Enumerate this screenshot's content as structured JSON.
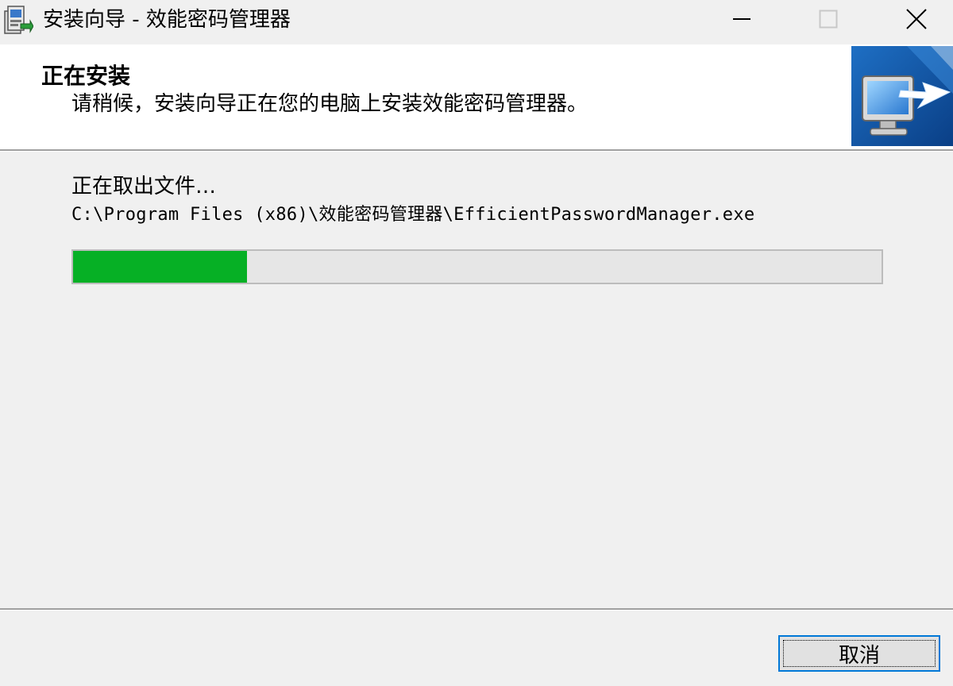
{
  "window": {
    "title": "安装向导 - 效能密码管理器",
    "app_icon": "installer-icon",
    "controls": {
      "minimize_icon": "minimize-icon",
      "maximize_icon": "maximize-icon",
      "close_icon": "close-icon"
    }
  },
  "header": {
    "title": "正在安装",
    "subtitle": "请稍候，安装向导正在您的电脑上安装效能密码管理器。",
    "image": "computer-install-icon"
  },
  "body": {
    "status": "正在取出文件…",
    "file_path": "C:\\Program Files (x86)\\效能密码管理器\\EfficientPasswordManager.exe",
    "progress_fraction": 0.215
  },
  "footer": {
    "cancel_label": "取消"
  },
  "colors": {
    "progress_fill": "#06b025",
    "progress_track": "#e6e6e6",
    "focus_border": "#0078d7",
    "background": "#f0f0f0"
  }
}
